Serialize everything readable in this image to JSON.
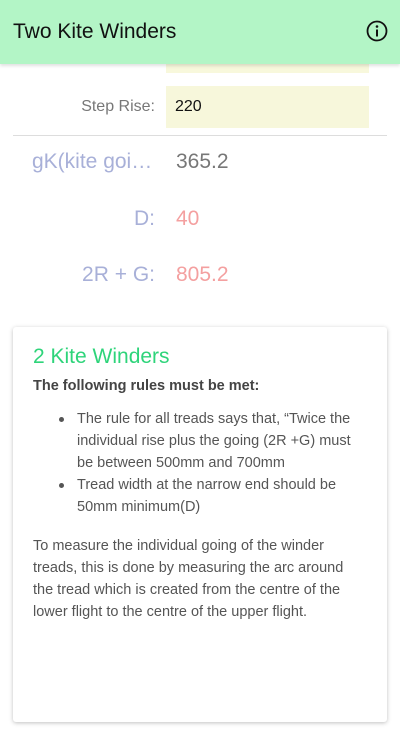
{
  "appbar": {
    "title": "Two Kite Winders",
    "info_icon": "info-circle-icon"
  },
  "form": {
    "step_rise": {
      "label": "Step Rise:",
      "value": "220"
    }
  },
  "results": {
    "gk": {
      "label": "gK(kite going):",
      "value": "365.2"
    },
    "d": {
      "label": "D:",
      "value": "40"
    },
    "two_r_g": {
      "label": "2R + G:",
      "value": "805.2"
    }
  },
  "card": {
    "title": "2 Kite Winders",
    "subtitle": "The following rules must be met:",
    "rules": [
      "The rule for all treads says that, “Twice the individual rise plus the going (2R +G) must be between 500mm and 700mm",
      "Tread width at the narrow end should be 50mm minimum(D)"
    ],
    "paragraph": "To measure the individual going of the winder treads, this is done by measuring the arc around the tread which is created from the centre of the lower flight to the centre of the upper flight."
  },
  "colors": {
    "appbar_bg": "#b3f5c6",
    "input_bg": "#f7f7db",
    "label_blue": "#a8b0d8",
    "value_red": "#f4a0a0",
    "title_green": "#2ed47a"
  }
}
